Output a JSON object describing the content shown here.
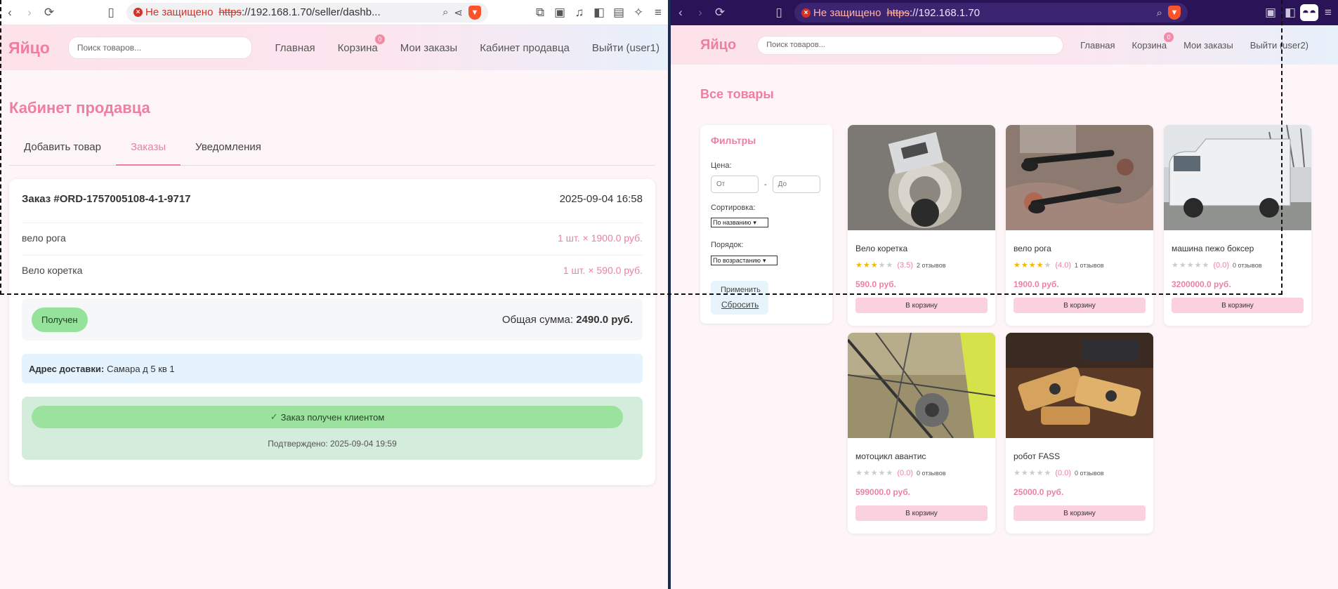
{
  "left_browser": {
    "not_secure": "Не защищено",
    "url_scheme": "https",
    "url_rest": "://192.168.1.70/seller/dashb..."
  },
  "right_browser": {
    "not_secure": "Не защищено",
    "url_scheme": "https",
    "url_rest": "://192.168.1.70"
  },
  "left_site": {
    "logo": "Яйцо",
    "search_placeholder": "Поиск товаров...",
    "nav": {
      "home": "Главная",
      "cart": "Корзина",
      "cart_badge": "0",
      "orders": "Мои заказы",
      "seller": "Кабинет продавца",
      "logout": "Выйти (user1)"
    }
  },
  "seller_dashboard": {
    "title": "Кабинет продавца",
    "tabs": [
      "Добавить товар",
      "Заказы",
      "Уведомления"
    ],
    "order": {
      "id": "Заказ #ORD-1757005108-4-1-9717",
      "date": "2025-09-04 16:58",
      "items": [
        {
          "name": "вело рога",
          "qty_price": "1 шт. × 1900.0 руб."
        },
        {
          "name": "Вело коретка",
          "qty_price": "1 шт. × 590.0 руб."
        }
      ],
      "status": "Получен",
      "total_label": "Общая сумма:",
      "total_value": "2490.0 руб.",
      "address_label": "Адрес доставки:",
      "address_value": "Самара д 5 кв 1",
      "confirm_check": "✓",
      "confirm_button": "Заказ получен клиентом",
      "confirmed_text": "Подтверждено: 2025-09-04 19:59"
    }
  },
  "right_site": {
    "logo": "Яйцо",
    "search_placeholder": "Поиск товаров...",
    "nav": {
      "home": "Главная",
      "cart": "Корзина",
      "cart_badge": "0",
      "orders": "Мои заказы",
      "logout": "Выйти (user2)"
    }
  },
  "catalog": {
    "title": "Все товары",
    "filters": {
      "title": "Фильтры",
      "price_label": "Цена:",
      "from_placeholder": "От",
      "to_placeholder": "До",
      "dash": "-",
      "sort_label": "Сортировка:",
      "sort_value": "По названию",
      "order_label": "Порядок:",
      "order_value": "По возрастанию",
      "apply": "Применить",
      "reset": "Сбросить"
    },
    "products": [
      {
        "name": "Вело коретка",
        "rating": 3.5,
        "rating_text": "(3.5)",
        "reviews": "2 отзывов",
        "price": "590.0 руб.",
        "cart": "В корзину"
      },
      {
        "name": "вело рога",
        "rating": 4.0,
        "rating_text": "(4.0)",
        "reviews": "1 отзывов",
        "price": "1900.0 руб.",
        "cart": "В корзину"
      },
      {
        "name": "машина пежо боксер",
        "rating": 0.0,
        "rating_text": "(0.0)",
        "reviews": "0 отзывов",
        "price": "3200000.0 руб.",
        "cart": "В корзину"
      },
      {
        "name": "мотоцикл авантис",
        "rating": 0.0,
        "rating_text": "(0.0)",
        "reviews": "0 отзывов",
        "price": "599000.0 руб.",
        "cart": "В корзину"
      },
      {
        "name": "робот FASS",
        "rating": 0.0,
        "rating_text": "(0.0)",
        "reviews": "0 отзывов",
        "price": "25000.0 руб.",
        "cart": "В корзину"
      }
    ]
  },
  "colors": {
    "accent_pink": "#ef7fa0",
    "status_green": "#95e39b",
    "confirm_bg": "#d4ecdb",
    "address_bg": "#e4f3fd",
    "right_toolbar": "#2a1457"
  }
}
